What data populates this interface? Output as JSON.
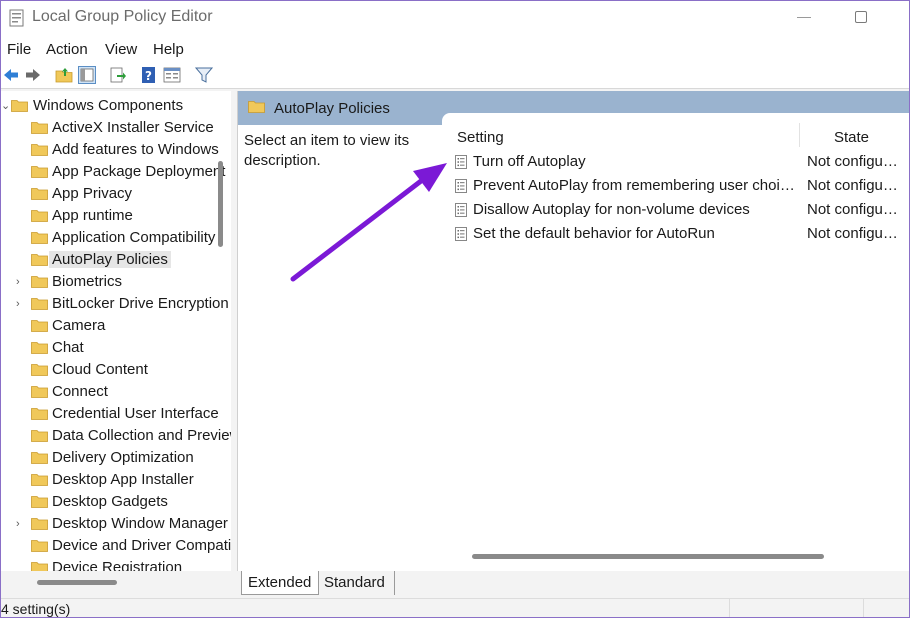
{
  "window": {
    "title": "Local Group Policy Editor"
  },
  "menu": {
    "file": "File",
    "action": "Action",
    "view": "View",
    "help": "Help"
  },
  "tree": {
    "root": "Windows Components",
    "items": [
      {
        "label": "ActiveX Installer Service",
        "expandable": false
      },
      {
        "label": "Add features to Windows",
        "expandable": false
      },
      {
        "label": "App Package Deployment",
        "expandable": false
      },
      {
        "label": "App Privacy",
        "expandable": false
      },
      {
        "label": "App runtime",
        "expandable": false
      },
      {
        "label": "Application Compatibility",
        "expandable": false
      },
      {
        "label": "AutoPlay Policies",
        "expandable": false,
        "selected": true
      },
      {
        "label": "Biometrics",
        "expandable": true
      },
      {
        "label": "BitLocker Drive Encryption",
        "expandable": true
      },
      {
        "label": "Camera",
        "expandable": false
      },
      {
        "label": "Chat",
        "expandable": false
      },
      {
        "label": "Cloud Content",
        "expandable": false
      },
      {
        "label": "Connect",
        "expandable": false
      },
      {
        "label": "Credential User Interface",
        "expandable": false
      },
      {
        "label": "Data Collection and Preview Builds",
        "expandable": false
      },
      {
        "label": "Delivery Optimization",
        "expandable": false
      },
      {
        "label": "Desktop App Installer",
        "expandable": false
      },
      {
        "label": "Desktop Gadgets",
        "expandable": false
      },
      {
        "label": "Desktop Window Manager",
        "expandable": true
      },
      {
        "label": "Device and Driver Compatibility",
        "expandable": false
      },
      {
        "label": "Device Registration",
        "expandable": false
      }
    ]
  },
  "right_pane": {
    "header": "AutoPlay Policies",
    "description": "Select an item to view its description.",
    "columns": {
      "setting": "Setting",
      "state": "State"
    },
    "rows": [
      {
        "setting": "Turn off Autoplay",
        "state": "Not configured"
      },
      {
        "setting": "Prevent AutoPlay from remembering user choices.",
        "state": "Not configured"
      },
      {
        "setting": "Disallow Autoplay for non-volume devices",
        "state": "Not configured"
      },
      {
        "setting": "Set the default behavior for AutoRun",
        "state": "Not configured"
      }
    ]
  },
  "tabs": {
    "extended": "Extended",
    "standard": "Standard"
  },
  "status": {
    "text": "4 setting(s)"
  },
  "colors": {
    "header_bg": "#9ab3cf",
    "folder": "#f0c85a",
    "annotation_arrow": "#7b19d6"
  }
}
